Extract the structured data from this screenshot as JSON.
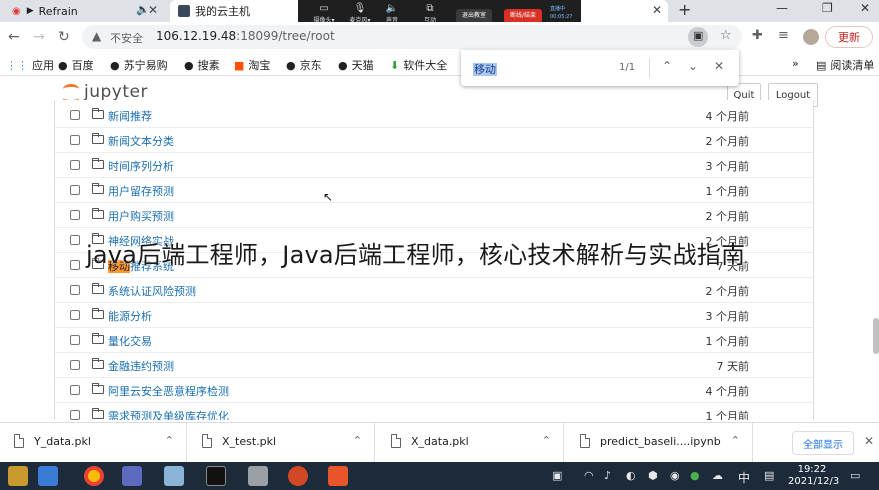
{
  "tabs": [
    {
      "title": "Refrain",
      "active": false
    },
    {
      "title": "我的云主机",
      "active": true
    }
  ],
  "meeting": {
    "camera": "摄像头",
    "mic": "麦克风",
    "sound": "声音",
    "interact": "互动",
    "leave": "退出教室",
    "end": "断线/结束",
    "live": "直播中",
    "timer": "00:05:27"
  },
  "address": {
    "insecure": "不安全",
    "host": "106.12.19.48",
    "path": ":18099/tree/root"
  },
  "update_label": "更新",
  "bookmarks": [
    {
      "label": "应用",
      "icon": "apps-grid-icon"
    },
    {
      "label": "百度",
      "icon": "globe-icon"
    },
    {
      "label": "苏宁易购",
      "icon": "globe-icon"
    },
    {
      "label": "搜素",
      "icon": "globe-icon"
    },
    {
      "label": "淘宝",
      "icon": "taobao-icon"
    },
    {
      "label": "京东",
      "icon": "globe-icon"
    },
    {
      "label": "天猫",
      "icon": "globe-icon"
    },
    {
      "label": "软件大全",
      "icon": "download-icon"
    }
  ],
  "reading_list": "阅读清单",
  "find": {
    "query": "移动",
    "count": "1/1"
  },
  "jupyter": {
    "logo_text": "jupyter",
    "quit": "Quit",
    "logout": "Logout"
  },
  "files": [
    {
      "name": "新闻推荐",
      "modified": "4 个月前"
    },
    {
      "name": "新闻文本分类",
      "modified": "2 个月前"
    },
    {
      "name": "时间序列分析",
      "modified": "3 个月前"
    },
    {
      "name": "用户留存预测",
      "modified": "1 个月前"
    },
    {
      "name": "用户购买预测",
      "modified": "2 个月前"
    },
    {
      "name": "神经网络实战",
      "modified": "2 个月前"
    },
    {
      "name": "移动推荐系统",
      "modified": "7 天前",
      "highlight": "移动",
      "rest": "推荐系统"
    },
    {
      "name": "系统认证风险预测",
      "modified": "2 个月前"
    },
    {
      "name": "能源分析",
      "modified": "3 个月前"
    },
    {
      "name": "量化交易",
      "modified": "1 个月前"
    },
    {
      "name": "金融违约预测",
      "modified": "7 天前"
    },
    {
      "name": "阿里云安全恶意程序检测",
      "modified": "4 个月前"
    },
    {
      "name": "需求预测及单级库存优化",
      "modified": "1 个月前"
    }
  ],
  "watermark": "java后端工程师，Java后端工程师，核心技术解析与实战指南",
  "downloads": [
    {
      "name": "Y_data.pkl"
    },
    {
      "name": "X_test.pkl"
    },
    {
      "name": "X_data.pkl"
    },
    {
      "name": "predict_baseli....ipynb"
    }
  ],
  "show_all": "全部显示",
  "taskbar": {
    "ime": "中",
    "time": "19:22",
    "date": "2021/12/3"
  },
  "colors": {
    "link": "#1a6fb0",
    "jupyter_orange": "#f37726",
    "taskbar": "#1c2a3a"
  }
}
